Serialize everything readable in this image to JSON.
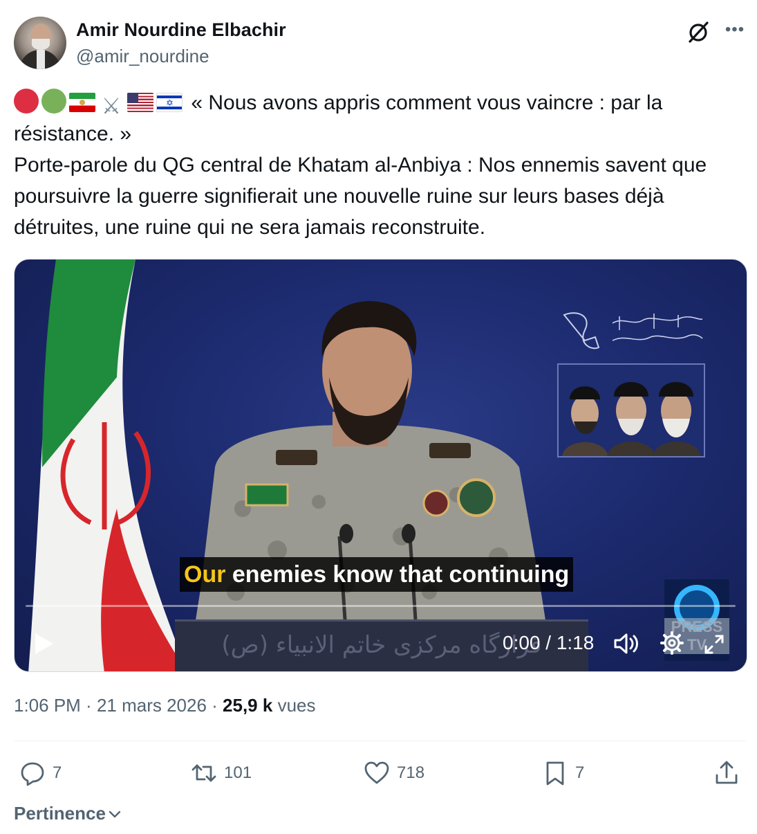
{
  "author": {
    "name": "Amir Nourdine Elbachir",
    "handle": "@amir_nourdine"
  },
  "tweet": {
    "emoji": [
      "red-circle",
      "green-circle",
      "iran-lion-sun-flag",
      "crossed-swords",
      "us-flag",
      "israel-flag"
    ],
    "quote": "« Nous avons appris comment vous vaincre : par la résistance. »",
    "body": "Porte-parole du QG central de Khatam al-Anbiya : Nos ennemis savent que poursuivre la guerre signifierait une nouvelle ruine sur leurs bases déjà détruites, une ruine qui ne sera jamais reconstruite."
  },
  "video": {
    "caption_highlight": "Our",
    "caption_rest": " enemies know that continuing",
    "podium_text": "قرارگاه مرکزی خاتم الانبیاء (ص)",
    "channel_logo_label": "PRESS TV",
    "time": "0:00 / 1:18",
    "progress": 0
  },
  "meta": {
    "time": "1:06 PM",
    "date": "21 mars 2026",
    "views_count": "25,9 k",
    "views_label": "vues"
  },
  "actions": {
    "replies": "7",
    "retweets": "101",
    "likes": "718",
    "bookmarks": "7"
  },
  "sort_label": "Pertinence",
  "colors": {
    "text": "#0f1419",
    "secondary": "#536471",
    "caption_highlight": "#f5c518"
  }
}
